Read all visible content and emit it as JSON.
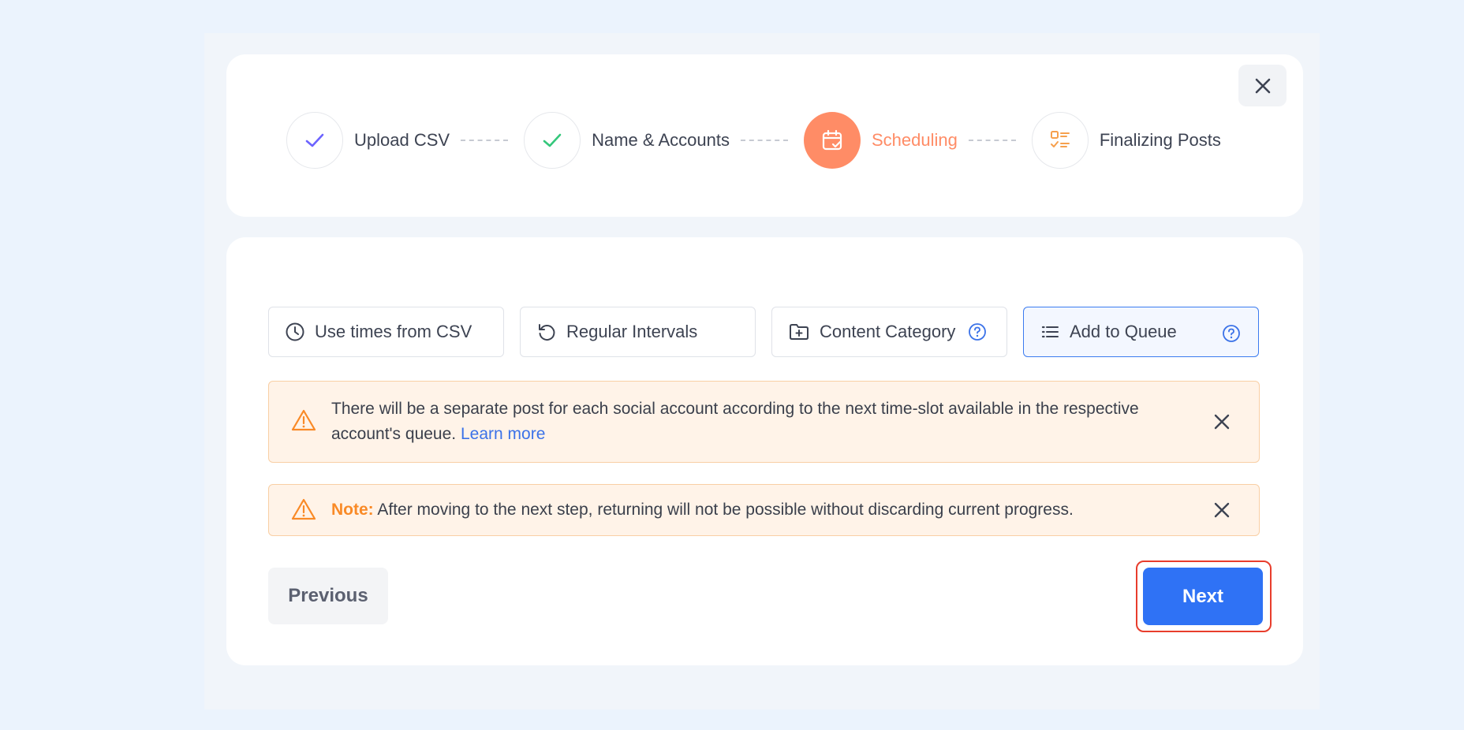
{
  "colors": {
    "accent": "#ff8c66",
    "primary": "#2f72f5",
    "success": "#34c77b",
    "check_purple": "#6c63ff",
    "warning": "#f98a27",
    "link": "#3b72e8"
  },
  "stepper": {
    "steps": [
      {
        "label": "Upload CSV",
        "status": "done",
        "icon": "check-icon"
      },
      {
        "label": "Name & Accounts",
        "status": "done",
        "icon": "check-icon"
      },
      {
        "label": "Scheduling",
        "status": "active",
        "icon": "calendar-check-icon"
      },
      {
        "label": "Finalizing Posts",
        "status": "pending",
        "icon": "checklist-icon"
      }
    ]
  },
  "options": [
    {
      "label": "Use times from CSV",
      "icon": "clock-icon",
      "selected": false
    },
    {
      "label": "Regular Intervals",
      "icon": "rotate-icon",
      "selected": false
    },
    {
      "label": "Content Category",
      "icon": "folder-plus-icon",
      "selected": false,
      "help": true
    },
    {
      "label": "Add to Queue",
      "icon": "list-icon",
      "selected": true,
      "help": true
    }
  ],
  "alerts": {
    "queue_info": {
      "text": "There will be a separate post for each social account according to the next time-slot available in the respective account's queue.",
      "link": "Learn more"
    },
    "note": {
      "label": "Note:",
      "text": "After moving to the next step, returning will not be possible without discarding current progress."
    }
  },
  "footer": {
    "previous_label": "Previous",
    "next_label": "Next"
  }
}
